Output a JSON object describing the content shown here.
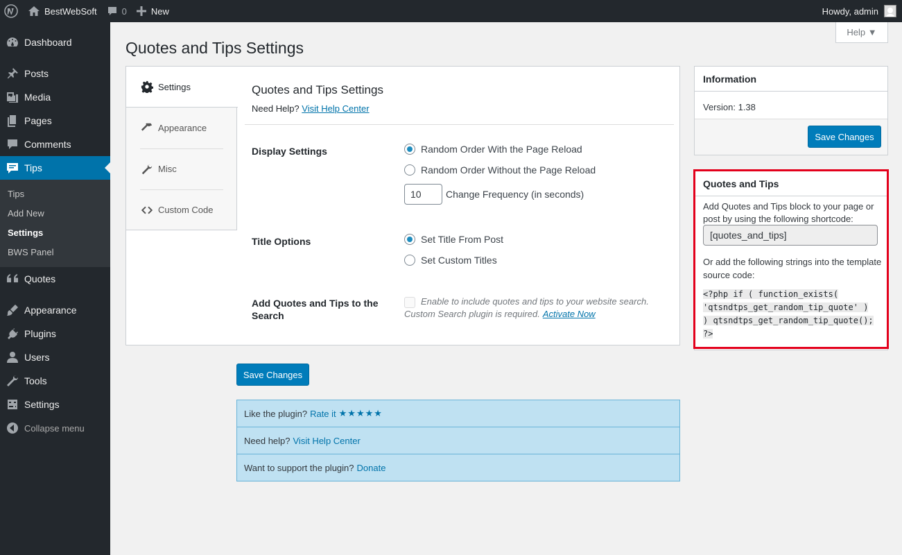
{
  "adminbar": {
    "site_name": "BestWebSoft",
    "comments_count": "0",
    "new_label": "New",
    "howdy": "Howdy, admin"
  },
  "sidebar": {
    "items": [
      {
        "label": "Dashboard",
        "icon": "dashboard-icon"
      },
      {
        "label": "Posts",
        "icon": "pushpin-icon"
      },
      {
        "label": "Media",
        "icon": "media-icon"
      },
      {
        "label": "Pages",
        "icon": "pages-icon"
      },
      {
        "label": "Comments",
        "icon": "comment-icon"
      },
      {
        "label": "Tips",
        "icon": "tips-icon"
      },
      {
        "label": "Quotes",
        "icon": "quote-icon"
      },
      {
        "label": "Appearance",
        "icon": "brush-icon"
      },
      {
        "label": "Plugins",
        "icon": "plugin-icon"
      },
      {
        "label": "Users",
        "icon": "user-icon"
      },
      {
        "label": "Tools",
        "icon": "wrench-icon"
      },
      {
        "label": "Settings",
        "icon": "settings-icon"
      }
    ],
    "submenu": [
      "Tips",
      "Add New",
      "Settings",
      "BWS Panel"
    ],
    "collapse_label": "Collapse menu"
  },
  "help_tab": "Help ▼",
  "page_title": "Quotes and Tips Settings",
  "tabs": [
    {
      "label": "Settings",
      "icon": "gear-icon"
    },
    {
      "label": "Appearance",
      "icon": "hammer-icon"
    },
    {
      "label": "Misc",
      "icon": "wrench-icon"
    },
    {
      "label": "Custom Code",
      "icon": "code-icon"
    }
  ],
  "panel": {
    "title": "Quotes and Tips Settings",
    "help_prefix": "Need Help?",
    "help_link": "Visit Help Center",
    "display_label": "Display Settings",
    "display_opt1": "Random Order With the Page Reload",
    "display_opt2": "Random Order Without the Page Reload",
    "frequency_value": "10",
    "frequency_label": "Change Frequency (in seconds)",
    "title_label": "Title Options",
    "title_opt1": "Set Title From Post",
    "title_opt2": "Set Custom Titles",
    "search_label": "Add Quotes and Tips to the Search",
    "search_desc1": "Enable to include quotes and tips to your website search.",
    "search_desc2": "Custom Search plugin is required.",
    "search_link": "Activate Now"
  },
  "save_label": "Save Changes",
  "rate": {
    "row1_text": "Like the plugin?",
    "row1_link": "Rate it",
    "row1_stars": "★★★★★",
    "row2_text": "Need help?",
    "row2_link": "Visit Help Center",
    "row3_text": "Want to support the plugin?",
    "row3_link": "Donate"
  },
  "info_box": {
    "title": "Information",
    "version": "Version: 1.38",
    "save_label": "Save Changes"
  },
  "qt_box": {
    "title": "Quotes and Tips",
    "text1": "Add Quotes and Tips block to your page or post by using the following shortcode:",
    "shortcode": "[quotes_and_tips]",
    "text2": "Or add the following strings into the template source code:",
    "code": "<?php if ( function_exists( 'qtsndtps_get_random_tip_quote' ) ) qtsndtps_get_random_tip_quote(); ?>"
  },
  "colors": {
    "accent": "#0073aa",
    "sidebar": "#23282d",
    "highlight_border": "#e3001b"
  }
}
